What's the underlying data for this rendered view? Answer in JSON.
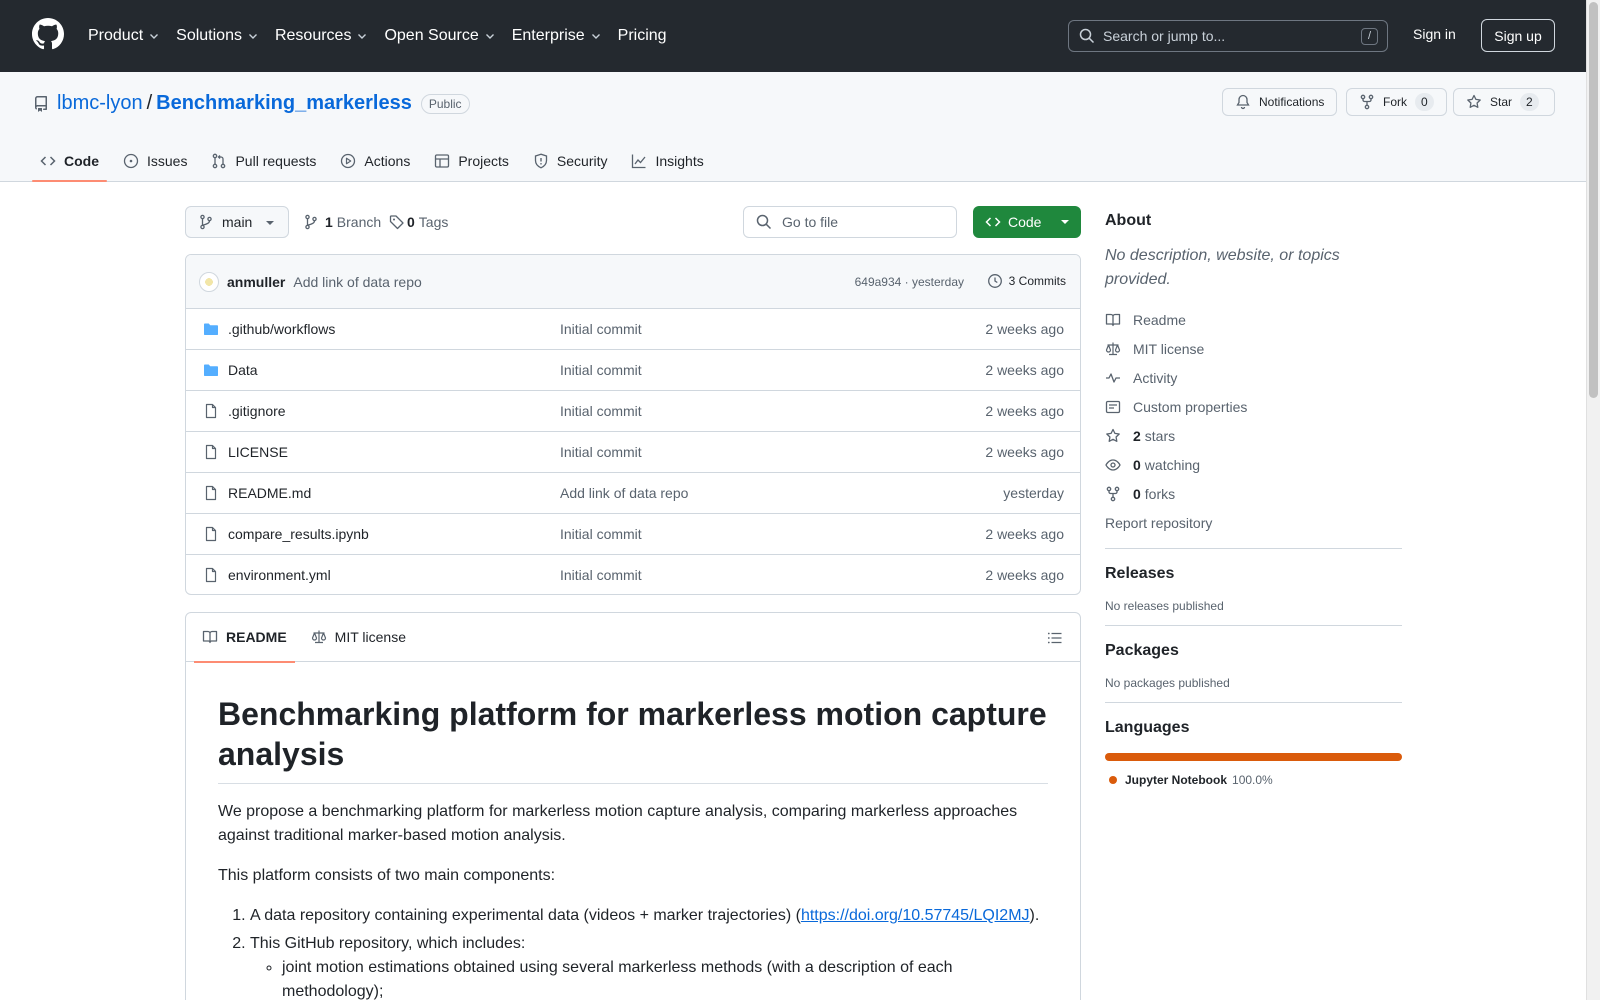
{
  "header": {
    "nav": [
      {
        "label": "Product",
        "dropdown": true
      },
      {
        "label": "Solutions",
        "dropdown": true
      },
      {
        "label": "Resources",
        "dropdown": true
      },
      {
        "label": "Open Source",
        "dropdown": true
      },
      {
        "label": "Enterprise",
        "dropdown": true
      },
      {
        "label": "Pricing",
        "dropdown": false
      }
    ],
    "search_placeholder": "Search or jump to...",
    "search_shortcut": "/",
    "signin": "Sign in",
    "signup": "Sign up"
  },
  "repo": {
    "owner": "lbmc-lyon",
    "separator": "/",
    "name": "Benchmarking_markerless",
    "visibility": "Public",
    "notifications_label": "Notifications",
    "fork_label": "Fork",
    "fork_count": "0",
    "star_label": "Star",
    "star_count": "2"
  },
  "tabs": [
    {
      "label": "Code",
      "icon": "code-icon",
      "active": true
    },
    {
      "label": "Issues",
      "icon": "issue-icon",
      "active": false
    },
    {
      "label": "Pull requests",
      "icon": "pull-request-icon",
      "active": false
    },
    {
      "label": "Actions",
      "icon": "play-icon",
      "active": false
    },
    {
      "label": "Projects",
      "icon": "table-icon",
      "active": false
    },
    {
      "label": "Security",
      "icon": "shield-icon",
      "active": false
    },
    {
      "label": "Insights",
      "icon": "graph-icon",
      "active": false
    }
  ],
  "toolbar": {
    "branch": "main",
    "branch_count": "1",
    "branch_label": "Branch",
    "tag_count": "0",
    "tag_label": "Tags",
    "goto_placeholder": "Go to file",
    "code_label": "Code"
  },
  "commit": {
    "author": "anmuller",
    "message": "Add link of data repo",
    "hash_time": "649a934 · yesterday",
    "commits_label": "3 Commits"
  },
  "files": [
    {
      "name": ".github/workflows",
      "type": "folder",
      "message": "Initial commit",
      "date": "2 weeks ago"
    },
    {
      "name": "Data",
      "type": "folder",
      "message": "Initial commit",
      "date": "2 weeks ago"
    },
    {
      "name": ".gitignore",
      "type": "file",
      "message": "Initial commit",
      "date": "2 weeks ago"
    },
    {
      "name": "LICENSE",
      "type": "file",
      "message": "Initial commit",
      "date": "2 weeks ago"
    },
    {
      "name": "README.md",
      "type": "file",
      "message": "Add link of data repo",
      "date": "yesterday"
    },
    {
      "name": "compare_results.ipynb",
      "type": "file",
      "message": "Initial commit",
      "date": "2 weeks ago"
    },
    {
      "name": "environment.yml",
      "type": "file",
      "message": "Initial commit",
      "date": "2 weeks ago"
    }
  ],
  "readme": {
    "tab_readme": "README",
    "tab_license": "MIT license",
    "title": "Benchmarking platform for markerless motion capture analysis",
    "intro": "We propose a benchmarking platform for markerless motion capture analysis, comparing markerless approaches against traditional marker-based motion analysis.",
    "components_intro": "This platform consists of two main components:",
    "item1_text": "A data repository containing experimental data (videos + marker trajectories) (",
    "item1_link": "https://doi.org/10.57745/LQI2MJ",
    "item1_end": ").",
    "item2_text": "This GitHub repository, which includes:",
    "item2_sub1": "joint motion estimations obtained using several markerless methods (with a description of each methodology);"
  },
  "sidebar": {
    "about_title": "About",
    "about_desc": "No description, website, or topics provided.",
    "links": [
      {
        "icon": "book-icon",
        "bold": "",
        "label": "Readme"
      },
      {
        "icon": "law-icon",
        "bold": "",
        "label": "MIT license"
      },
      {
        "icon": "pulse-icon",
        "bold": "",
        "label": "Activity"
      },
      {
        "icon": "note-icon",
        "bold": "",
        "label": "Custom properties"
      },
      {
        "icon": "star-icon",
        "bold": "2",
        "label": "stars"
      },
      {
        "icon": "eye-icon",
        "bold": "0",
        "label": "watching"
      },
      {
        "icon": "fork-icon",
        "bold": "0",
        "label": "forks"
      }
    ],
    "report": "Report repository",
    "releases_title": "Releases",
    "releases_empty": "No releases published",
    "packages_title": "Packages",
    "packages_empty": "No packages published",
    "languages_title": "Languages",
    "language": {
      "name": "Jupyter Notebook",
      "percent": "100.0%",
      "color": "#da5b0b",
      "share": 1.0
    }
  },
  "colors": {
    "header_bg": "#24292f",
    "link": "#0969da",
    "code_button": "#1f883d",
    "active_tab_underline": "#fd8c73"
  }
}
